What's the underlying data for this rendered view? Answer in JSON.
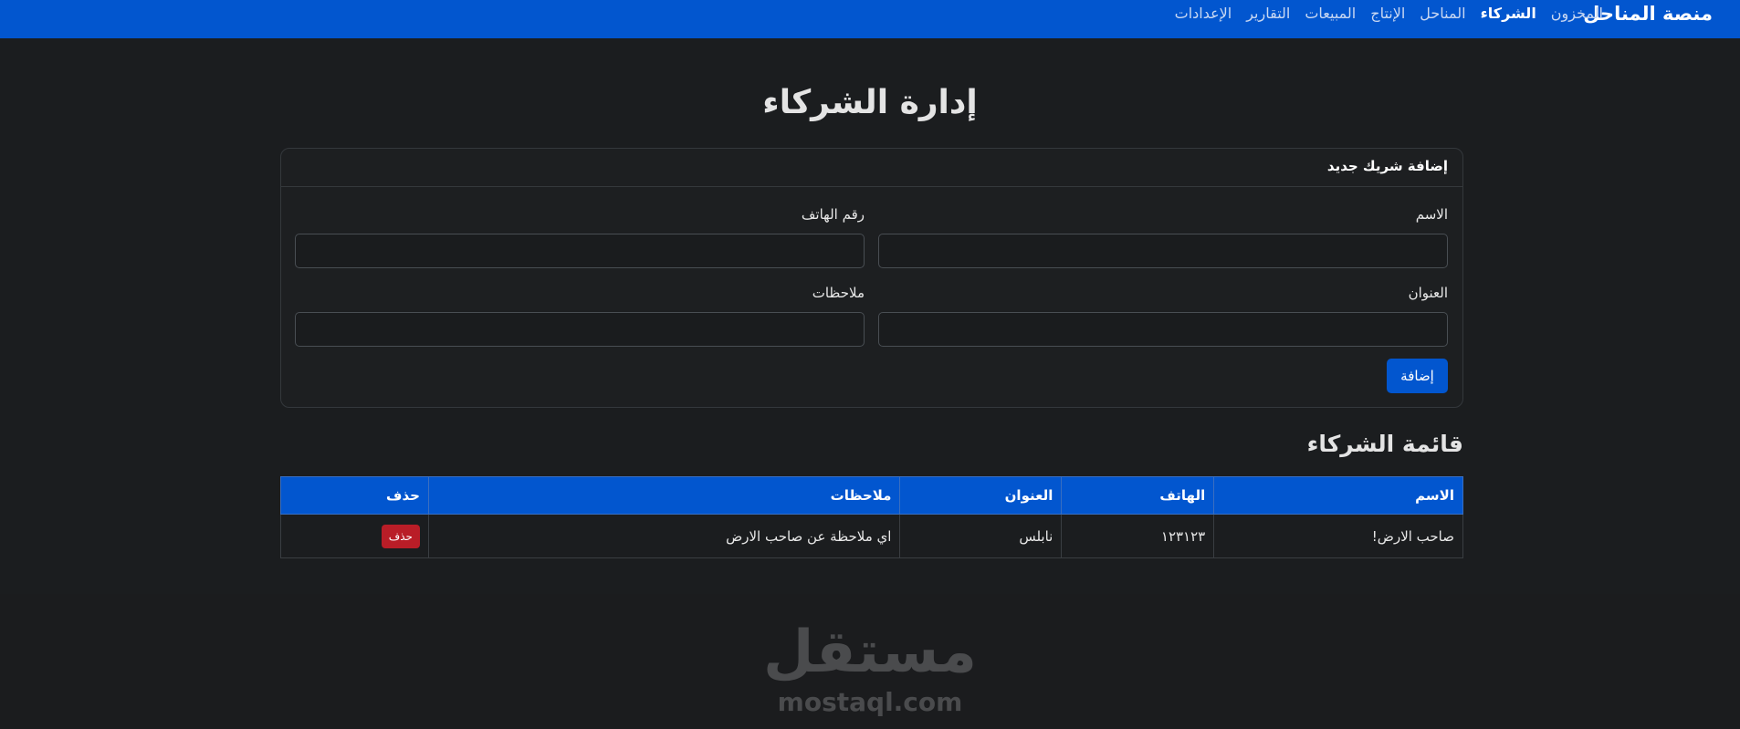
{
  "nav": {
    "brand": "منصة المناحل",
    "links": [
      "المخزون",
      "الشركاء",
      "المناحل",
      "الإنتاج",
      "المبيعات",
      "التقارير",
      "الإعدادات"
    ],
    "active": "الشركاء"
  },
  "page": {
    "title": "إدارة الشركاء"
  },
  "form": {
    "header": "إضافة شريك جديد",
    "name_label": "الاسم",
    "phone_label": "رقم الهاتف",
    "address_label": "العنوان",
    "notes_label": "ملاحظات",
    "name_value": "",
    "phone_value": "",
    "address_value": "",
    "notes_value": "",
    "submit_label": "إضافة"
  },
  "list": {
    "title": "قائمة الشركاء",
    "columns": [
      "الاسم",
      "الهاتف",
      "العنوان",
      "ملاحظات",
      "حذف"
    ],
    "rows": [
      {
        "name": "صاحب الارض!",
        "phone": "١٢٣١٢٣",
        "address": "نابلس",
        "notes": "اي ملاحظة عن صاحب الارض",
        "delete_label": "حذف"
      }
    ]
  },
  "watermark": {
    "arabic": "مستقل",
    "latin": "mostaql.com"
  },
  "colors": {
    "primary": "#0256cf",
    "danger": "#b91d27",
    "background": "#1b1d1f"
  }
}
